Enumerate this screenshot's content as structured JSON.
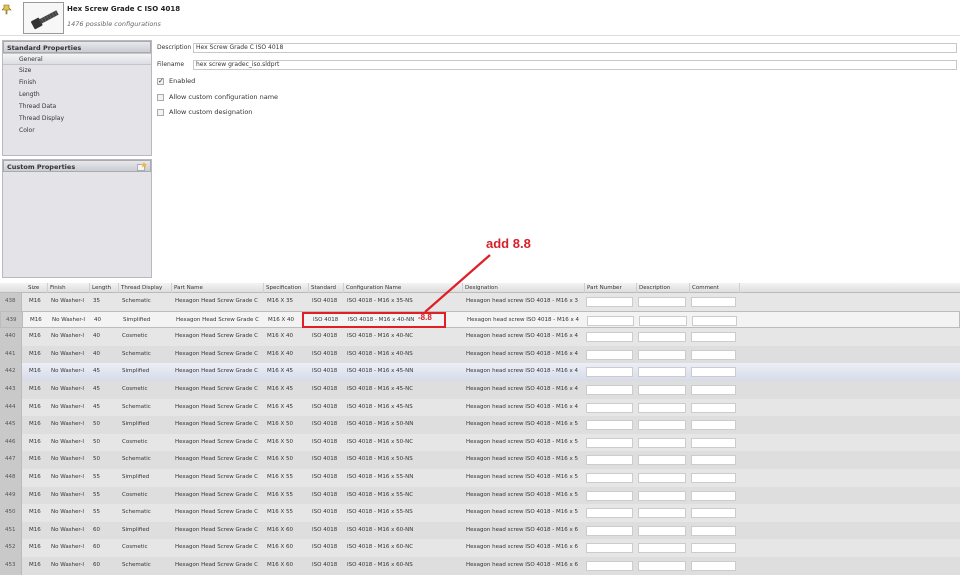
{
  "header": {
    "title": "Hex Screw Grade C ISO 4018",
    "subtitle": "1476 possible configurations"
  },
  "standard_properties": {
    "title": "Standard Properties",
    "items": [
      {
        "label": "General",
        "selected": true
      },
      {
        "label": "Size"
      },
      {
        "label": "Finish"
      },
      {
        "label": "Length"
      },
      {
        "label": "Thread Data"
      },
      {
        "label": "Thread Display"
      },
      {
        "label": "Color"
      }
    ]
  },
  "custom_properties": {
    "title": "Custom Properties"
  },
  "form": {
    "description_label": "Description",
    "description_value": "Hex Screw Grade C ISO 4018",
    "filename_label": "Filename",
    "filename_value": "hex screw gradec_iso.sldprt",
    "enabled_label": "Enabled",
    "enabled_checked": true,
    "custom_config_label": "Allow custom configuration name",
    "custom_config_checked": false,
    "custom_desig_label": "Allow custom designation",
    "custom_desig_checked": false
  },
  "grid": {
    "columns": [
      "Size",
      "Finish",
      "Length",
      "Thread Display",
      "Part Name",
      "Specification",
      "Standard",
      "Configuration Name",
      "Designation",
      "Part Number",
      "Description",
      "Comment"
    ],
    "rows": [
      {
        "num": "438",
        "size": "M16",
        "finish": "No Washer-I",
        "length": "35",
        "thread": "Schematic",
        "part": "Hexagon Head Screw Grade C",
        "spec": "M16 X 35",
        "std": "ISO 4018",
        "config": "ISO 4018 - M16 x 35-NS",
        "desig": "Hexagon head screw ISO 4018 - M16 x 3"
      },
      {
        "num": "439",
        "size": "M16",
        "finish": "No Washer-I",
        "length": "40",
        "thread": "Simplified",
        "part": "Hexagon Head Screw Grade C",
        "spec": "M16 X 40",
        "std": "ISO 4018",
        "config": "ISO 4018 - M16 x 40-NN",
        "desig": "Hexagon head screw ISO 4018 - M16 x 4",
        "edit": true
      },
      {
        "num": "440",
        "size": "M16",
        "finish": "No Washer-I",
        "length": "40",
        "thread": "Cosmetic",
        "part": "Hexagon Head Screw Grade C",
        "spec": "M16 X 40",
        "std": "ISO 4018",
        "config": "ISO 4018 - M16 x 40-NC",
        "desig": "Hexagon head screw ISO 4018 - M16 x 4"
      },
      {
        "num": "441",
        "size": "M16",
        "finish": "No Washer-I",
        "length": "40",
        "thread": "Schematic",
        "part": "Hexagon Head Screw Grade C",
        "spec": "M16 X 40",
        "std": "ISO 4018",
        "config": "ISO 4018 - M16 x 40-NS",
        "desig": "Hexagon head screw ISO 4018 - M16 x 4"
      },
      {
        "num": "442",
        "size": "M16",
        "finish": "No Washer-I",
        "length": "45",
        "thread": "Simplified",
        "part": "Hexagon Head Screw Grade C",
        "spec": "M16 X 45",
        "std": "ISO 4018",
        "config": "ISO 4018 - M16 x 45-NN",
        "desig": "Hexagon head screw ISO 4018 - M16 x 4",
        "selected": true
      },
      {
        "num": "443",
        "size": "M16",
        "finish": "No Washer-I",
        "length": "45",
        "thread": "Cosmetic",
        "part": "Hexagon Head Screw Grade C",
        "spec": "M16 X 45",
        "std": "ISO 4018",
        "config": "ISO 4018 - M16 x 45-NC",
        "desig": "Hexagon head screw ISO 4018 - M16 x 4"
      },
      {
        "num": "444",
        "size": "M16",
        "finish": "No Washer-I",
        "length": "45",
        "thread": "Schematic",
        "part": "Hexagon Head Screw Grade C",
        "spec": "M16 X 45",
        "std": "ISO 4018",
        "config": "ISO 4018 - M16 x 45-NS",
        "desig": "Hexagon head screw ISO 4018 - M16 x 4"
      },
      {
        "num": "445",
        "size": "M16",
        "finish": "No Washer-I",
        "length": "50",
        "thread": "Simplified",
        "part": "Hexagon Head Screw Grade C",
        "spec": "M16 X 50",
        "std": "ISO 4018",
        "config": "ISO 4018 - M16 x 50-NN",
        "desig": "Hexagon head screw ISO 4018 - M16 x 5"
      },
      {
        "num": "446",
        "size": "M16",
        "finish": "No Washer-I",
        "length": "50",
        "thread": "Cosmetic",
        "part": "Hexagon Head Screw Grade C",
        "spec": "M16 X 50",
        "std": "ISO 4018",
        "config": "ISO 4018 - M16 x 50-NC",
        "desig": "Hexagon head screw ISO 4018 - M16 x 5"
      },
      {
        "num": "447",
        "size": "M16",
        "finish": "No Washer-I",
        "length": "50",
        "thread": "Schematic",
        "part": "Hexagon Head Screw Grade C",
        "spec": "M16 X 50",
        "std": "ISO 4018",
        "config": "ISO 4018 - M16 x 50-NS",
        "desig": "Hexagon head screw ISO 4018 - M16 x 5"
      },
      {
        "num": "448",
        "size": "M16",
        "finish": "No Washer-I",
        "length": "55",
        "thread": "Simplified",
        "part": "Hexagon Head Screw Grade C",
        "spec": "M16 X 55",
        "std": "ISO 4018",
        "config": "ISO 4018 - M16 x 55-NN",
        "desig": "Hexagon head screw ISO 4018 - M16 x 5"
      },
      {
        "num": "449",
        "size": "M16",
        "finish": "No Washer-I",
        "length": "55",
        "thread": "Cosmetic",
        "part": "Hexagon Head Screw Grade C",
        "spec": "M16 X 55",
        "std": "ISO 4018",
        "config": "ISO 4018 - M16 x 55-NC",
        "desig": "Hexagon head screw ISO 4018 - M16 x 5"
      },
      {
        "num": "450",
        "size": "M16",
        "finish": "No Washer-I",
        "length": "55",
        "thread": "Schematic",
        "part": "Hexagon Head Screw Grade C",
        "spec": "M16 X 55",
        "std": "ISO 4018",
        "config": "ISO 4018 - M16 x 55-NS",
        "desig": "Hexagon head screw ISO 4018 - M16 x 5"
      },
      {
        "num": "451",
        "size": "M16",
        "finish": "No Washer-I",
        "length": "60",
        "thread": "Simplified",
        "part": "Hexagon Head Screw Grade C",
        "spec": "M16 X 60",
        "std": "ISO 4018",
        "config": "ISO 4018 - M16 x 60-NN",
        "desig": "Hexagon head screw ISO 4018 - M16 x 6"
      },
      {
        "num": "452",
        "size": "M16",
        "finish": "No Washer-I",
        "length": "60",
        "thread": "Cosmetic",
        "part": "Hexagon Head Screw Grade C",
        "spec": "M16 X 60",
        "std": "ISO 4018",
        "config": "ISO 4018 - M16 x 60-NC",
        "desig": "Hexagon head screw ISO 4018 - M16 x 6"
      },
      {
        "num": "453",
        "size": "M16",
        "finish": "No Washer-I",
        "length": "60",
        "thread": "Schematic",
        "part": "Hexagon Head Screw Grade C",
        "spec": "M16 X 60",
        "std": "ISO 4018",
        "config": "ISO 4018 - M16 x 60-NS",
        "desig": "Hexagon head screw ISO 4018 - M16 x 6"
      }
    ]
  },
  "annotation": {
    "text": "add 8.8",
    "suffix": "-8.8",
    "color": "#d6202a"
  }
}
